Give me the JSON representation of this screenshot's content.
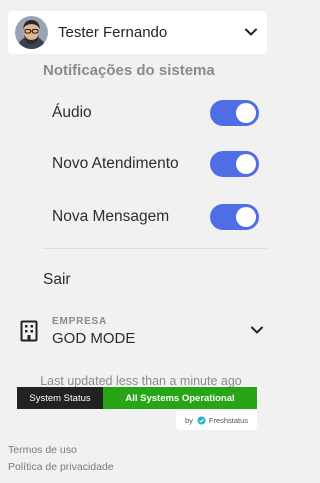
{
  "user": {
    "name": "Tester Fernando",
    "avatar_icon": "user-avatar",
    "chevron_icon": "chevron-down-icon"
  },
  "notifications": {
    "title": "Notificações do sistema",
    "items": [
      {
        "label": "Áudio",
        "enabled": true
      },
      {
        "label": "Novo Atendimento",
        "enabled": true
      },
      {
        "label": "Nova Mensagem",
        "enabled": true
      }
    ]
  },
  "menu": {
    "logout_label": "Sair"
  },
  "company": {
    "label": "EMPRESA",
    "name": "GOD MODE",
    "icon": "building-icon"
  },
  "status": {
    "updated_text": "Last updated less than a minute ago",
    "system_label": "System Status",
    "state_label": "All Systems Operational",
    "by_label": "by",
    "provider_name": "Freshstatus"
  },
  "footer": {
    "terms": "Termos de uso",
    "privacy": "Política de privacidade"
  },
  "colors": {
    "accent": "#4f6de5",
    "status_ok": "#28a516",
    "status_dark": "#222222",
    "background": "#f1f1f2"
  }
}
